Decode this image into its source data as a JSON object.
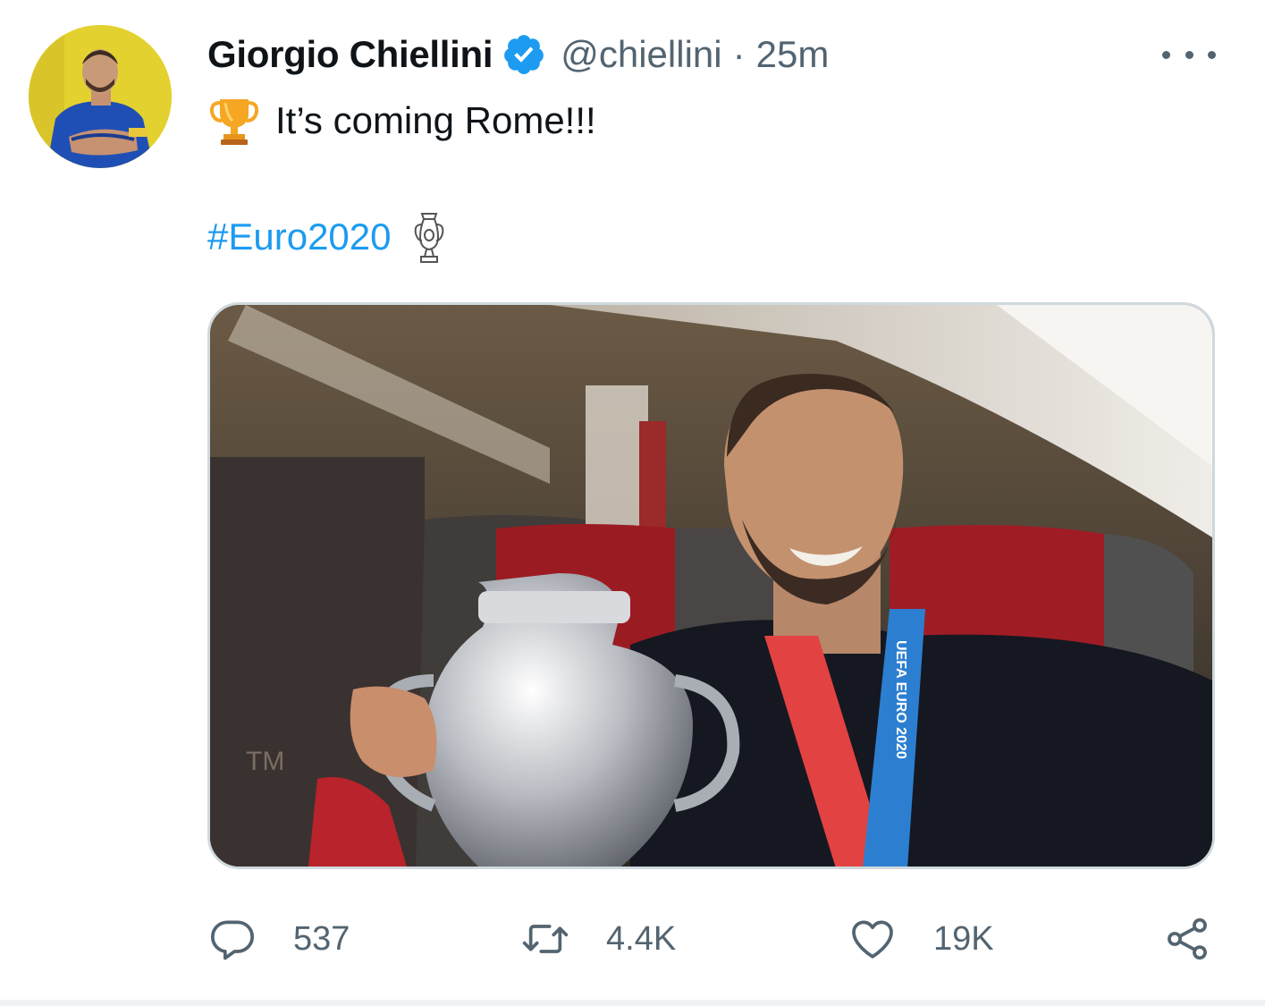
{
  "tweet": {
    "author_name": "Giorgio Chiellini",
    "handle": "@chiellini",
    "separator": "·",
    "time": "25m",
    "text": "It’s coming Rome!!!",
    "hashtag": "#Euro2020",
    "media_text": {
      "lanyard": "UEFA EURO 2020",
      "trademark": "TM"
    }
  },
  "actions": {
    "replies": "537",
    "retweets": "4.4K",
    "likes": "19K"
  },
  "icons": {
    "verified": "verified-badge-icon",
    "more": "more-horizontal-icon",
    "trophy": "trophy-emoji",
    "cup": "euro-cup-emoji",
    "reply": "reply-icon",
    "retweet": "retweet-icon",
    "like": "heart-icon",
    "share": "share-icon"
  },
  "colors": {
    "link": "#1d9bf0",
    "secondary_text": "#536471",
    "primary_text": "#0f1419",
    "verified": "#1d9bf0",
    "border": "#cfd9de"
  }
}
